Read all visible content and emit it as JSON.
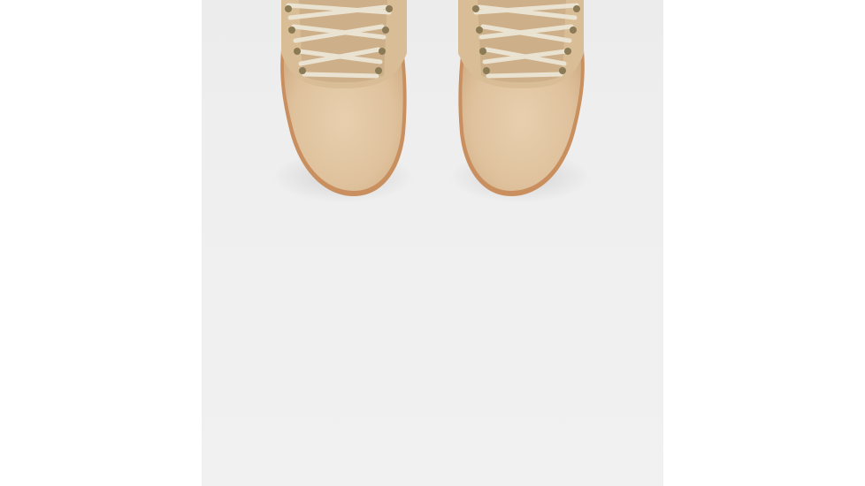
{
  "image": {
    "subject": "boots-top-view",
    "colors": {
      "background": "#f0f0f0",
      "suede": "#e3c9a6",
      "sole": "#c98f5e",
      "laces": "#ebe3d2",
      "eyelets": "#8a7a55"
    }
  }
}
